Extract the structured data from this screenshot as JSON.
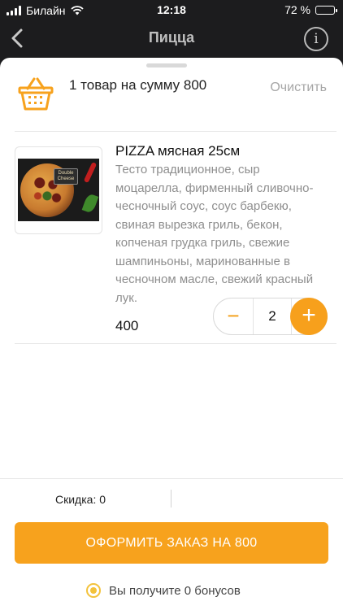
{
  "status_bar": {
    "carrier": "Билайн",
    "time": "12:18",
    "battery": "72 %",
    "battery_level": 0.72
  },
  "nav": {
    "title": "Пицца",
    "info_label": "i"
  },
  "cart": {
    "summary": "1 товар на сумму 800",
    "clear_label": "Очистить"
  },
  "item": {
    "image_badge": "Double Cheese",
    "title": "PIZZA мясная 25см",
    "description": "Тесто традиционное, сыр моцарелла, фирменный сливочно-чесночный соус, соус барбекю, свиная вырезка гриль, бекон, копченая грудка гриль, свежие шампиньоны, маринованные в чесночном масле, свежий красный лук.",
    "price": "400",
    "quantity": "2",
    "minus_label": "−",
    "plus_label": "+"
  },
  "footer": {
    "discount": "Скидка: 0",
    "checkout_label": "ОФОРМИТЬ ЗАКАЗ НА 800",
    "bonus_text": "Вы получите 0 бонусов"
  },
  "colors": {
    "accent": "#f7a21d",
    "header_bg": "#1c1c1e"
  }
}
